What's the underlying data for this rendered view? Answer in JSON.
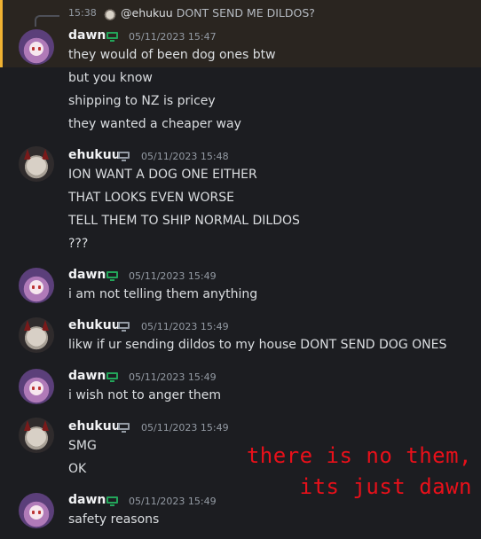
{
  "reply": {
    "time": "15:38",
    "author": "@ehukuu",
    "text": "DONT SEND ME DILDOS?"
  },
  "groups": [
    {
      "author": "dawn",
      "timestamp": "05/11/2023 15:47",
      "lines": [
        "they would of been dog ones btw",
        "but you know",
        "shipping to NZ is pricey",
        "they wanted a cheaper way"
      ]
    },
    {
      "author": "ehukuu",
      "timestamp": "05/11/2023 15:48",
      "lines": [
        "ION WANT A DOG ONE EITHER",
        "THAT LOOKS EVEN WORSE",
        "TELL THEM TO SHIP NORMAL DILDOS",
        "???"
      ]
    },
    {
      "author": "dawn",
      "timestamp": "05/11/2023 15:49",
      "lines": [
        "i am not telling them anything"
      ]
    },
    {
      "author": "ehukuu",
      "timestamp": "05/11/2023 15:49",
      "lines": [
        "likw if ur sending dildos to my house DONT SEND DOG ONES"
      ]
    },
    {
      "author": "dawn",
      "timestamp": "05/11/2023 15:49",
      "lines": [
        "i wish not to anger them"
      ]
    },
    {
      "author": "ehukuu",
      "timestamp": "05/11/2023 15:49",
      "lines": [
        "SMG",
        "OK"
      ]
    },
    {
      "author": "dawn",
      "timestamp": "05/11/2023 15:49",
      "lines": [
        "safety reasons"
      ]
    }
  ],
  "overlay": {
    "line1": "there is no them,",
    "line2": "its just dawn"
  },
  "colors": {
    "highlight_bar": "#f0b232",
    "online_desktop": "#23a55a",
    "overlay_text": "#e8101a"
  },
  "icons": {
    "dawn_platform": "desktop-icon",
    "ehukuu_platform": "desktop-icon"
  }
}
